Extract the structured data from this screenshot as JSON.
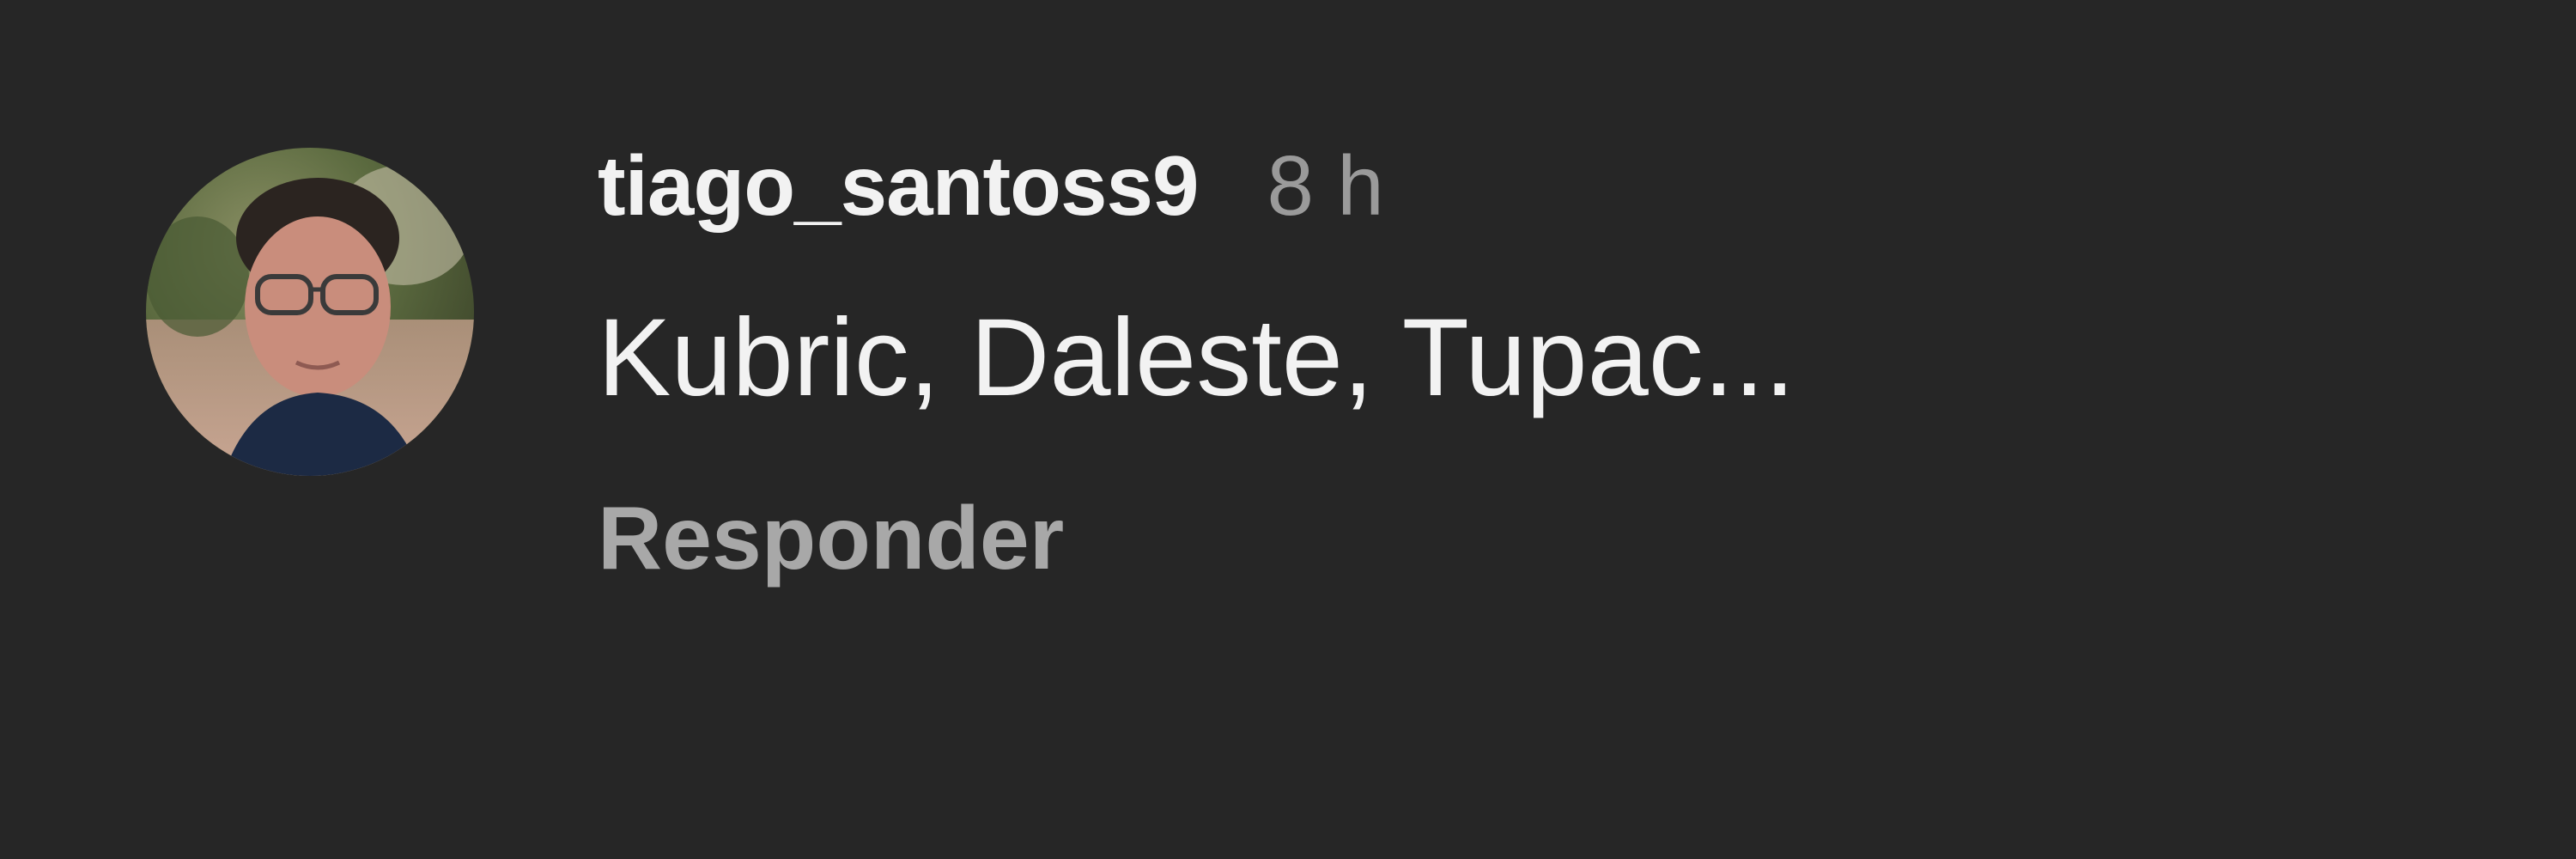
{
  "comment": {
    "username": "tiago_santoss9",
    "time": "8 h",
    "text": "Kubric, Daleste, Tupac...",
    "reply_label": "Responder"
  },
  "colors": {
    "background": "#262626",
    "primary_text": "#f2f2f2",
    "secondary_text": "#9a9a9a",
    "reply_text": "#a8a8a8"
  },
  "icons": {
    "avatar": "user-profile-photo"
  }
}
